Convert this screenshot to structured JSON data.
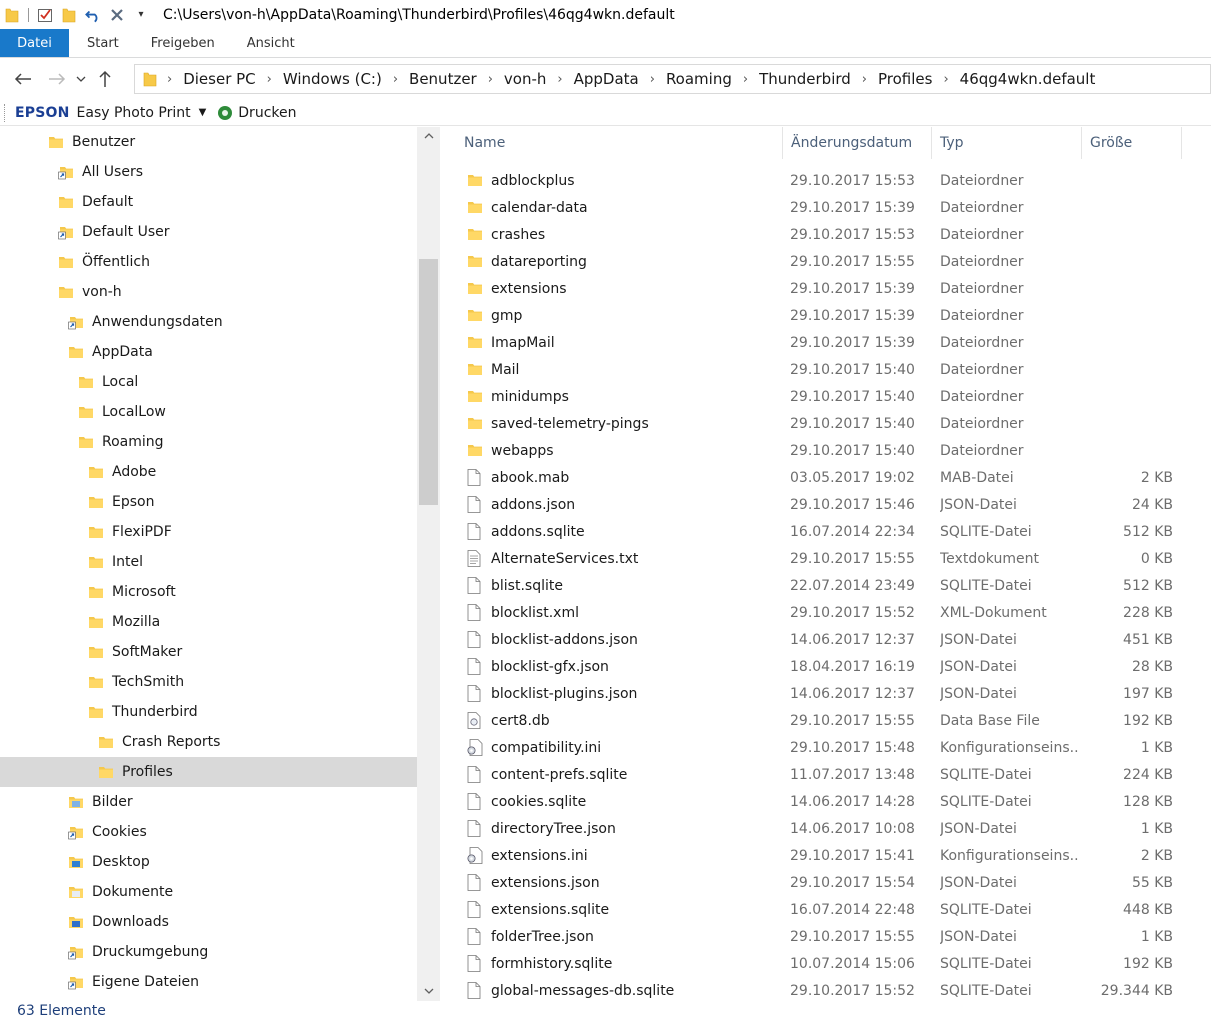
{
  "titlebar": {
    "path": "C:\\Users\\von-h\\AppData\\Roaming\\Thunderbird\\Profiles\\46qg4wkn.default",
    "quick_access_icons": [
      "folder-icon",
      "properties-check-icon",
      "new-folder-icon",
      "undo-icon",
      "delete-x-icon",
      "customize-dropdown-icon"
    ]
  },
  "ribbon": {
    "tabs": [
      "Datei",
      "Start",
      "Freigeben",
      "Ansicht"
    ],
    "active_color": "#1979ca"
  },
  "address": {
    "crumbs": [
      "Dieser PC",
      "Windows (C:)",
      "Benutzer",
      "von-h",
      "AppData",
      "Roaming",
      "Thunderbird",
      "Profiles",
      "46qg4wkn.default"
    ]
  },
  "toolbar": {
    "brand": "EPSON",
    "app": "Easy Photo Print",
    "print": "Drucken"
  },
  "tree": [
    {
      "label": "Benutzer",
      "icon": "folder-icon"
    },
    {
      "label": "All Users",
      "icon": "shortcut-folder-icon"
    },
    {
      "label": "Default",
      "icon": "folder-icon"
    },
    {
      "label": "Default User",
      "icon": "shortcut-folder-icon"
    },
    {
      "label": "Öffentlich",
      "icon": "folder-icon"
    },
    {
      "label": "von-h",
      "icon": "folder-icon"
    },
    {
      "label": "Anwendungsdaten",
      "icon": "shortcut-folder-icon"
    },
    {
      "label": "AppData",
      "icon": "folder-icon"
    },
    {
      "label": "Local",
      "icon": "folder-icon"
    },
    {
      "label": "LocalLow",
      "icon": "folder-icon"
    },
    {
      "label": "Roaming",
      "icon": "folder-icon"
    },
    {
      "label": "Adobe",
      "icon": "folder-icon"
    },
    {
      "label": "Epson",
      "icon": "folder-icon"
    },
    {
      "label": "FlexiPDF",
      "icon": "folder-icon"
    },
    {
      "label": "Intel",
      "icon": "folder-icon"
    },
    {
      "label": "Microsoft",
      "icon": "folder-icon"
    },
    {
      "label": "Mozilla",
      "icon": "folder-icon"
    },
    {
      "label": "SoftMaker",
      "icon": "folder-icon"
    },
    {
      "label": "TechSmith",
      "icon": "folder-icon"
    },
    {
      "label": "Thunderbird",
      "icon": "folder-icon"
    },
    {
      "label": "Crash Reports",
      "icon": "folder-icon"
    },
    {
      "label": "Profiles",
      "icon": "folder-icon",
      "selected": true
    },
    {
      "label": "Bilder",
      "icon": "pictures-folder-icon"
    },
    {
      "label": "Cookies",
      "icon": "shortcut-folder-icon"
    },
    {
      "label": "Desktop",
      "icon": "desktop-folder-icon"
    },
    {
      "label": "Dokumente",
      "icon": "documents-folder-icon"
    },
    {
      "label": "Downloads",
      "icon": "downloads-folder-icon"
    },
    {
      "label": "Druckumgebung",
      "icon": "shortcut-folder-icon"
    },
    {
      "label": "Eigene Dateien",
      "icon": "shortcut-folder-icon"
    }
  ],
  "columns": {
    "name": "Name",
    "date": "Änderungsdatum",
    "type": "Typ",
    "size": "Größe"
  },
  "files": [
    {
      "name": "adblockplus",
      "date": "29.10.2017 15:53",
      "type": "Dateiordner",
      "size": "",
      "icon": "folder-icon"
    },
    {
      "name": "calendar-data",
      "date": "29.10.2017 15:39",
      "type": "Dateiordner",
      "size": "",
      "icon": "folder-icon"
    },
    {
      "name": "crashes",
      "date": "29.10.2017 15:53",
      "type": "Dateiordner",
      "size": "",
      "icon": "folder-icon"
    },
    {
      "name": "datareporting",
      "date": "29.10.2017 15:55",
      "type": "Dateiordner",
      "size": "",
      "icon": "folder-icon"
    },
    {
      "name": "extensions",
      "date": "29.10.2017 15:39",
      "type": "Dateiordner",
      "size": "",
      "icon": "folder-icon"
    },
    {
      "name": "gmp",
      "date": "29.10.2017 15:39",
      "type": "Dateiordner",
      "size": "",
      "icon": "folder-icon"
    },
    {
      "name": "ImapMail",
      "date": "29.10.2017 15:39",
      "type": "Dateiordner",
      "size": "",
      "icon": "folder-icon"
    },
    {
      "name": "Mail",
      "date": "29.10.2017 15:40",
      "type": "Dateiordner",
      "size": "",
      "icon": "folder-icon"
    },
    {
      "name": "minidumps",
      "date": "29.10.2017 15:40",
      "type": "Dateiordner",
      "size": "",
      "icon": "folder-icon"
    },
    {
      "name": "saved-telemetry-pings",
      "date": "29.10.2017 15:40",
      "type": "Dateiordner",
      "size": "",
      "icon": "folder-icon"
    },
    {
      "name": "webapps",
      "date": "29.10.2017 15:40",
      "type": "Dateiordner",
      "size": "",
      "icon": "folder-icon"
    },
    {
      "name": "abook.mab",
      "date": "03.05.2017 19:02",
      "type": "MAB-Datei",
      "size": "2 KB",
      "icon": "file-icon"
    },
    {
      "name": "addons.json",
      "date": "29.10.2017 15:46",
      "type": "JSON-Datei",
      "size": "24 KB",
      "icon": "file-icon"
    },
    {
      "name": "addons.sqlite",
      "date": "16.07.2014 22:34",
      "type": "SQLITE-Datei",
      "size": "512 KB",
      "icon": "file-icon"
    },
    {
      "name": "AlternateServices.txt",
      "date": "29.10.2017 15:55",
      "type": "Textdokument",
      "size": "0 KB",
      "icon": "text-file-icon"
    },
    {
      "name": "blist.sqlite",
      "date": "22.07.2014 23:49",
      "type": "SQLITE-Datei",
      "size": "512 KB",
      "icon": "file-icon"
    },
    {
      "name": "blocklist.xml",
      "date": "29.10.2017 15:52",
      "type": "XML-Dokument",
      "size": "228 KB",
      "icon": "file-icon"
    },
    {
      "name": "blocklist-addons.json",
      "date": "14.06.2017 12:37",
      "type": "JSON-Datei",
      "size": "451 KB",
      "icon": "file-icon"
    },
    {
      "name": "blocklist-gfx.json",
      "date": "18.04.2017 16:19",
      "type": "JSON-Datei",
      "size": "28 KB",
      "icon": "file-icon"
    },
    {
      "name": "blocklist-plugins.json",
      "date": "14.06.2017 12:37",
      "type": "JSON-Datei",
      "size": "197 KB",
      "icon": "file-icon"
    },
    {
      "name": "cert8.db",
      "date": "29.10.2017 15:55",
      "type": "Data Base File",
      "size": "192 KB",
      "icon": "db-file-icon"
    },
    {
      "name": "compatibility.ini",
      "date": "29.10.2017 15:48",
      "type": "Konfigurationseins...",
      "size": "1 KB",
      "icon": "ini-file-icon"
    },
    {
      "name": "content-prefs.sqlite",
      "date": "11.07.2017 13:48",
      "type": "SQLITE-Datei",
      "size": "224 KB",
      "icon": "file-icon"
    },
    {
      "name": "cookies.sqlite",
      "date": "14.06.2017 14:28",
      "type": "SQLITE-Datei",
      "size": "128 KB",
      "icon": "file-icon"
    },
    {
      "name": "directoryTree.json",
      "date": "14.06.2017 10:08",
      "type": "JSON-Datei",
      "size": "1 KB",
      "icon": "file-icon"
    },
    {
      "name": "extensions.ini",
      "date": "29.10.2017 15:41",
      "type": "Konfigurationseins...",
      "size": "2 KB",
      "icon": "ini-file-icon"
    },
    {
      "name": "extensions.json",
      "date": "29.10.2017 15:54",
      "type": "JSON-Datei",
      "size": "55 KB",
      "icon": "file-icon"
    },
    {
      "name": "extensions.sqlite",
      "date": "16.07.2014 22:48",
      "type": "SQLITE-Datei",
      "size": "448 KB",
      "icon": "file-icon"
    },
    {
      "name": "folderTree.json",
      "date": "29.10.2017 15:55",
      "type": "JSON-Datei",
      "size": "1 KB",
      "icon": "file-icon"
    },
    {
      "name": "formhistory.sqlite",
      "date": "10.07.2014 15:06",
      "type": "SQLITE-Datei",
      "size": "192 KB",
      "icon": "file-icon"
    },
    {
      "name": "global-messages-db.sqlite",
      "date": "29.10.2017 15:52",
      "type": "SQLITE-Datei",
      "size": "29.344 KB",
      "icon": "file-icon"
    }
  ],
  "status": {
    "count": "63 Elemente"
  }
}
